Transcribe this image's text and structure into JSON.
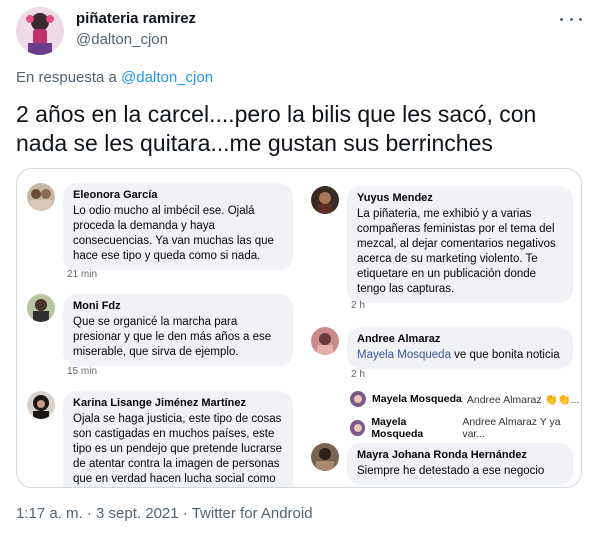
{
  "tweet": {
    "display_name": "piñateria ramirez",
    "handle": "@dalton_cjon",
    "reply_prefix": "En respuesta a ",
    "reply_mention": "@dalton_cjon",
    "text": "2 años en la carcel....pero la bilis que les sacó, con nada se les quitara...me gustan sus berrinches",
    "time": "1:17 a. m.",
    "separator": " · ",
    "date": "3 sept. 2021",
    "source": "Twitter for Android",
    "more_icon": "more-horizontal-icon"
  },
  "screenshot": {
    "left_column": [
      {
        "name": "Eleonora García",
        "text": "Lo odio mucho al imbécil ese. Ojalá proceda la demanda y haya consecuencias. Ya van muchas las que hace ese tipo y queda como si nada.",
        "time": "21 min"
      },
      {
        "name": "Moni Fdz",
        "text": "Que se organicé la marcha para presionar y que le den más años a ese miserable, que sirva de ejemplo.",
        "time": "15 min"
      },
      {
        "name": "Karina Lisange Jiménez Martínez",
        "text": "Ojala se haga justicia, este tipo de cosas son castigadas en muchos países, este tipo es un pendejo que pretende lucrarse de atentar contra la imagen de personas que en verdad hacen lucha social como"
      }
    ],
    "right_column": [
      {
        "name": "Yuyus Mendez",
        "text": "La piñateria, me exhibió y a varias compañeras feministas por el tema del mezcal, al dejar comentarios negativos acerca de su marketing violento. Te etiquetare en un publicación donde tengo las capturas.",
        "time": "2 h"
      },
      {
        "name": "Andree Almaraz",
        "link": "Mayela Mosqueda",
        "text": " ve que bonita noticia",
        "time": "2 h"
      },
      {
        "name": "Mayra Johana Ronda Hernández",
        "text": "Siempre he detestado a ese negocio"
      }
    ],
    "replies": [
      {
        "name": "Mayela Mosqueda",
        "text": "Andree Almaraz 👏👏..."
      },
      {
        "name": "Mayela Mosqueda",
        "text": "Andree Almaraz Y ya var..."
      }
    ]
  }
}
